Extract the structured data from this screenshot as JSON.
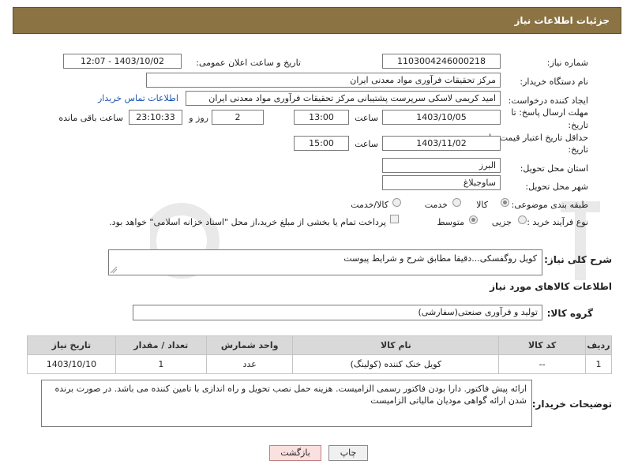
{
  "header": {
    "title": "جزئیات اطلاعات نیاز"
  },
  "form": {
    "need_number_label": "شماره نیاز:",
    "need_number": "1103004246000218",
    "announce_datetime_label": "تاریخ و ساعت اعلان عمومی:",
    "announce_datetime": "1403/10/02 - 12:07",
    "buyer_org_label": "نام دستگاه خریدار:",
    "buyer_org": "مرکز تحقیقات فرآوری مواد معدنی ایران",
    "creator_label": "ایجاد کننده درخواست:",
    "creator": "امید کریمی لاسکی سرپرست پشتیبانی مرکز تحقیقات فرآوری مواد معدنی ایران",
    "contact_link": "اطلاعات تماس خریدار",
    "reply_deadline_label_1": "مهلت ارسال پاسخ: تا",
    "reply_deadline_label_2": "تاریخ:",
    "reply_date": "1403/10/05",
    "hour_label": "ساعت",
    "reply_time": "13:00",
    "days_value": "2",
    "days_label": "روز و",
    "remaining_time": "23:10:33",
    "remaining_label": "ساعت باقی مانده",
    "min_validity_label_1": "حداقل تاریخ اعتبار قیمت: تا",
    "min_validity_label_2": "تاریخ:",
    "validity_date": "1403/11/02",
    "validity_hour_label": "ساعت",
    "validity_time": "15:00",
    "province_label": "استان محل تحویل:",
    "province": "البرز",
    "city_label": "شهر محل تحویل:",
    "city": "ساوجبلاغ",
    "category_label": "طبقه بندی موضوعی:",
    "category_options": [
      "کالا",
      "خدمت",
      "کالا/خدمت"
    ],
    "purchase_type_label": "نوع فرآیند خرید :",
    "purchase_options": [
      "جزیی",
      "متوسط"
    ],
    "payment_note": "پرداخت تمام یا بخشی از مبلغ خرید،از محل \"اسناد خزانه اسلامی\" خواهد بود."
  },
  "summary": {
    "label": "شرح کلی نیاز:",
    "text": "کویل روگفسکی...دقیقا مطابق شرح و شرایط پیوست"
  },
  "goods_section": {
    "title": "اطلاعات کالاهای مورد نیاز",
    "group_label": "گروه کالا:",
    "group_value": "تولید و فرآوری صنعتی(سفارشی)"
  },
  "table": {
    "headers": [
      "ردیف",
      "کد کالا",
      "نام کالا",
      "واحد شمارش",
      "تعداد / مقدار",
      "تاریخ نیاز"
    ],
    "rows": [
      [
        "1",
        "--",
        "کویل خنک کننده (کولینگ)",
        "عدد",
        "1",
        "1403/10/10"
      ]
    ]
  },
  "buyer_notes": {
    "label": "توضیحات خریدار:",
    "text": "ارائه پیش فاکتور. دارا بودن فاکتور رسمی الزامیست. هزینه حمل نصب تحویل و راه اندازی با تامین کننده می باشد. در صورت برنده شدن ارائه گواهی مودیان مالیاتی الزامیست"
  },
  "buttons": {
    "print": "چاپ",
    "back": "بازگشت"
  },
  "colors": {
    "header": "#8b7344",
    "link": "#1a56b0",
    "table_header": "#d9d9d9",
    "back_button": "#fbe0e0"
  }
}
